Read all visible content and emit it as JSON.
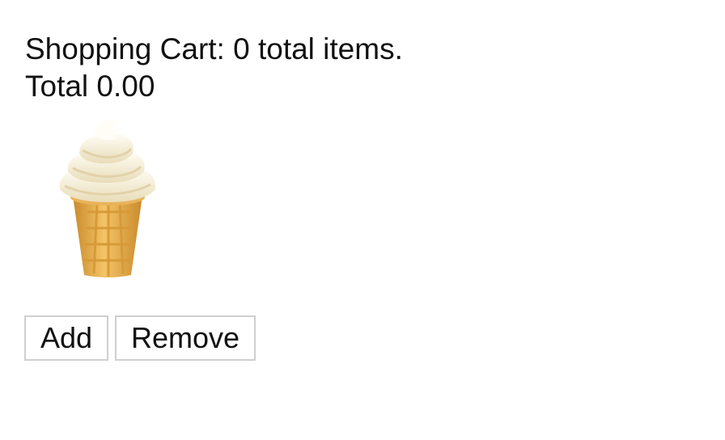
{
  "cart": {
    "summary_text": "Shopping Cart: 0 total items.",
    "total_text": "Total 0.00"
  },
  "product": {
    "icon": "soft-ice-cream-icon"
  },
  "actions": {
    "add_label": "Add",
    "remove_label": "Remove"
  }
}
